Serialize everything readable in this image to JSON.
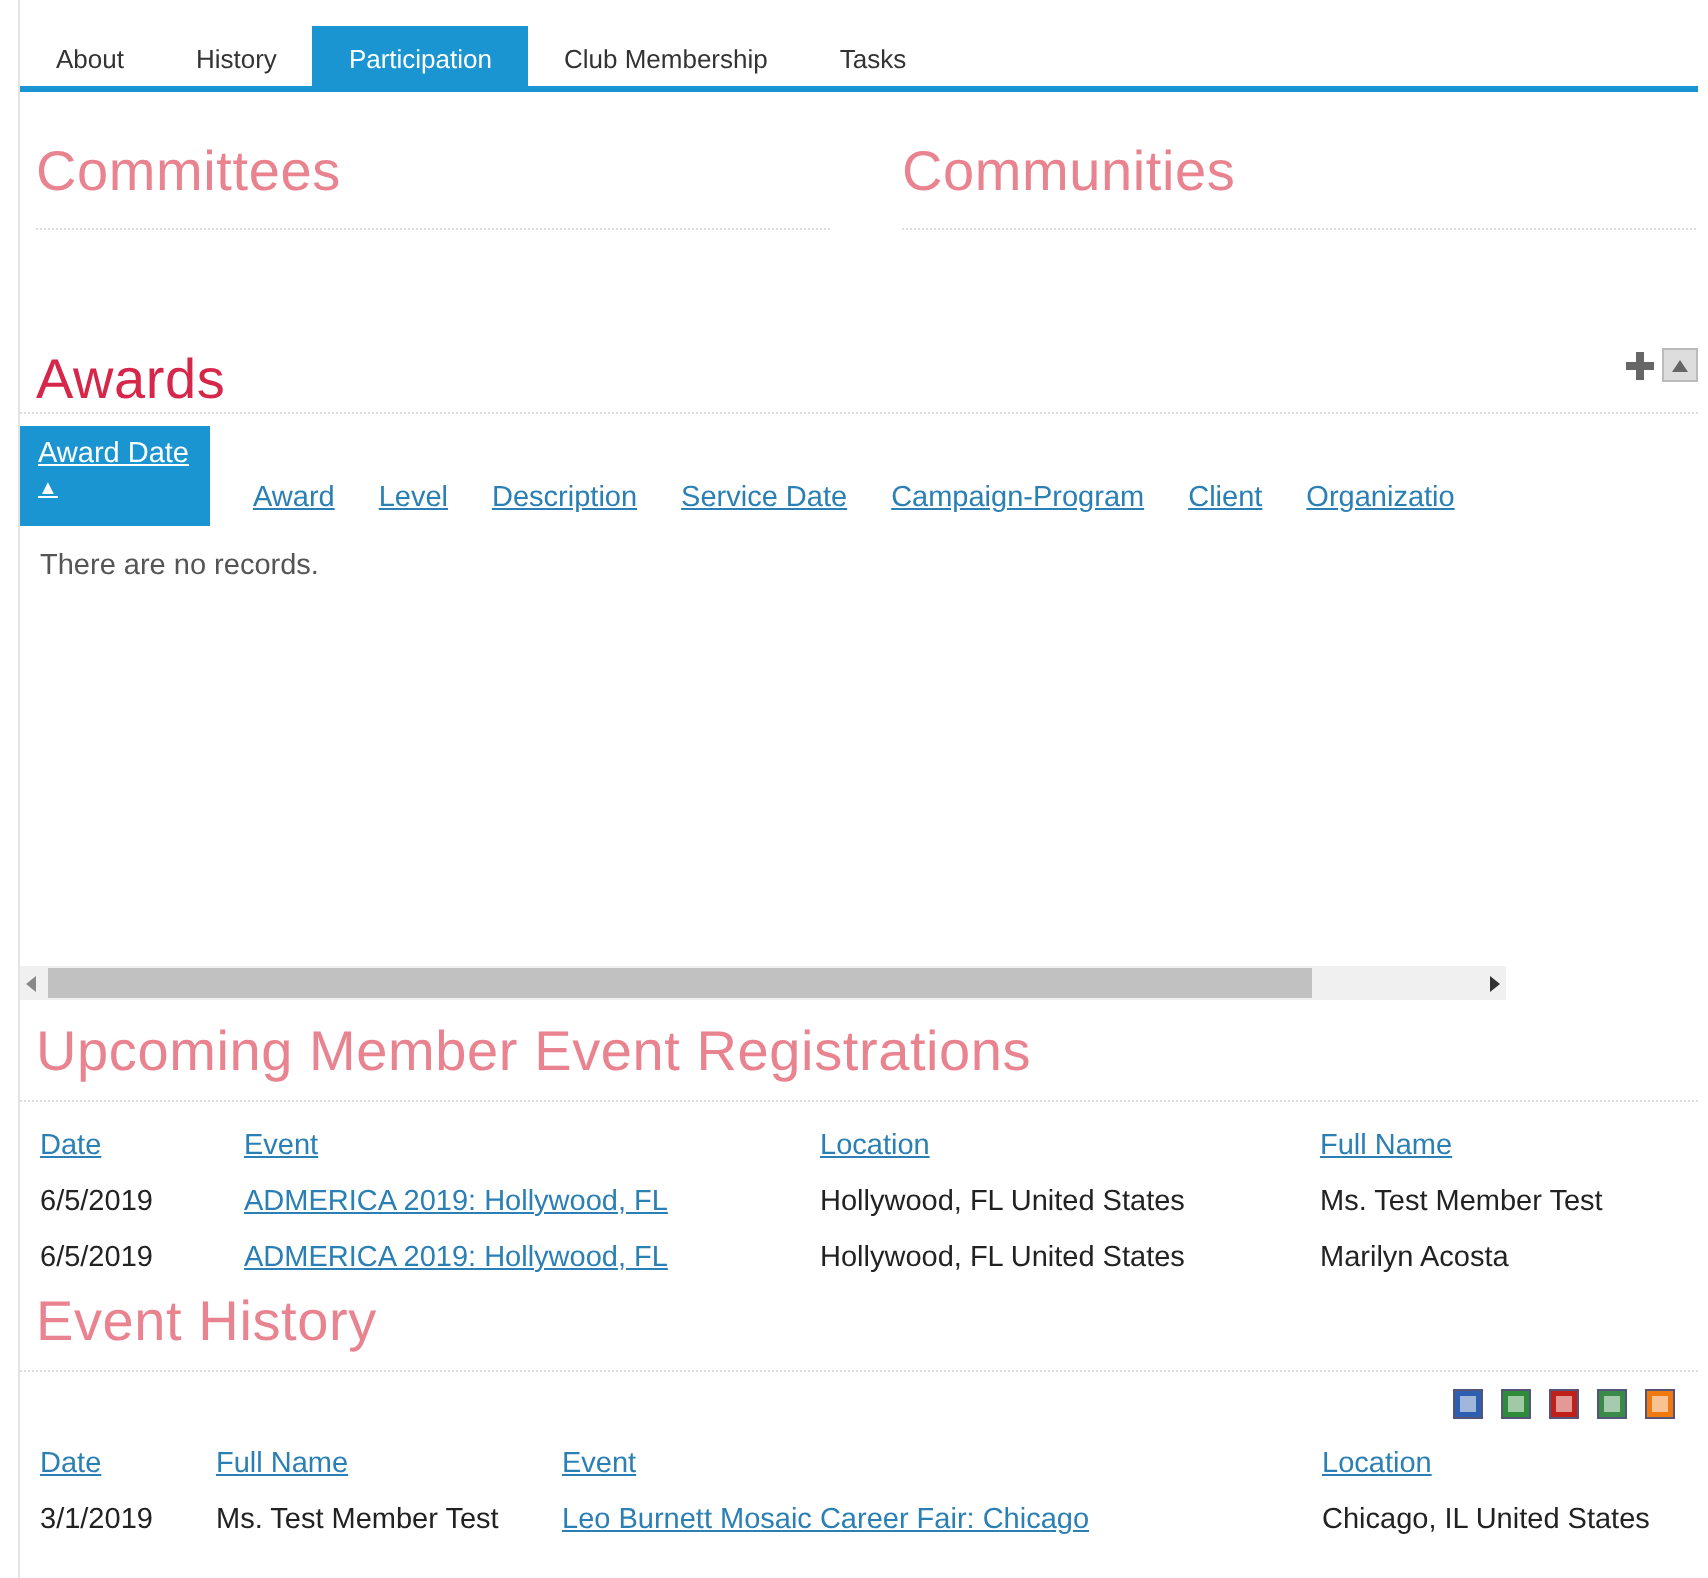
{
  "tabs": [
    {
      "label": "About",
      "selected": false
    },
    {
      "label": "History",
      "selected": false
    },
    {
      "label": "Participation",
      "selected": true
    },
    {
      "label": "Club Membership",
      "selected": false
    },
    {
      "label": "Tasks",
      "selected": false
    }
  ],
  "top_sections": [
    {
      "title": "Committees"
    },
    {
      "title": "Communities"
    }
  ],
  "awards": {
    "title": "Awards",
    "columns": [
      {
        "label": "Award Date",
        "selected": true,
        "sort": "▲"
      },
      {
        "label": "Award",
        "selected": false
      },
      {
        "label": "Level",
        "selected": false
      },
      {
        "label": "Description",
        "selected": false
      },
      {
        "label": "Service Date",
        "selected": false
      },
      {
        "label": "Campaign-Program",
        "selected": false
      },
      {
        "label": "Client",
        "selected": false
      },
      {
        "label": "Organizatio",
        "selected": false
      }
    ],
    "empty_message": "There are no records."
  },
  "upcoming_registrations": {
    "title": "Upcoming Member Event Registrations",
    "columns": [
      "Date",
      "Event",
      "Location",
      "Full Name"
    ],
    "rows": [
      [
        {
          "text": "6/5/2019",
          "kind": "text"
        },
        {
          "text": "ADMERICA 2019: Hollywood, FL",
          "kind": "link"
        },
        {
          "text": "Hollywood, FL United States",
          "kind": "text"
        },
        {
          "text": "Ms. Test Member Test",
          "kind": "text"
        }
      ],
      [
        {
          "text": "6/5/2019",
          "kind": "text"
        },
        {
          "text": "ADMERICA 2019: Hollywood, FL",
          "kind": "link"
        },
        {
          "text": "Hollywood, FL United States",
          "kind": "text"
        },
        {
          "text": "Marilyn Acosta",
          "kind": "text"
        }
      ]
    ]
  },
  "event_history": {
    "title": "Event History",
    "exports": [
      {
        "kind": "word"
      },
      {
        "kind": "excel"
      },
      {
        "kind": "pdf"
      },
      {
        "kind": "csv"
      },
      {
        "kind": "xml"
      }
    ],
    "columns": [
      "Date",
      "Full Name",
      "Event",
      "Location"
    ],
    "rows": [
      [
        {
          "text": "3/1/2019",
          "kind": "text"
        },
        {
          "text": "Ms. Test Member Test",
          "kind": "text"
        },
        {
          "text": "Leo Burnett Mosaic Career Fair: Chicago",
          "kind": "link"
        },
        {
          "text": "Chicago, IL United States",
          "kind": "text"
        }
      ]
    ]
  }
}
